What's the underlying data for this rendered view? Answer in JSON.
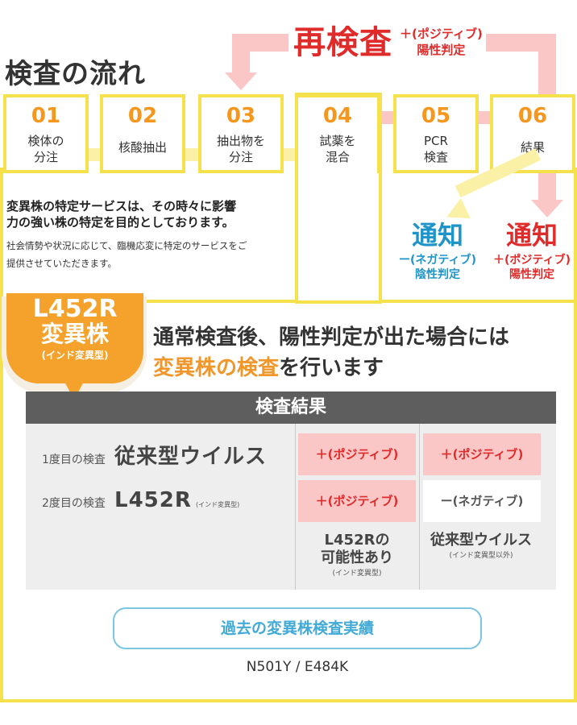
{
  "page_title": "検査の流れ",
  "retest": {
    "title": "再検査",
    "sub1": "＋(ポジティブ)",
    "sub2": "陽性判定"
  },
  "steps": [
    {
      "num": "01",
      "line1": "検体の",
      "line2": "分注"
    },
    {
      "num": "02",
      "line1": "核酸抽出",
      "line2": ""
    },
    {
      "num": "03",
      "line1": "抽出物を",
      "line2": "分注"
    },
    {
      "num": "04",
      "line1": "試薬を",
      "line2": "混合"
    },
    {
      "num": "05",
      "line1": "PCR",
      "line2": "検査"
    },
    {
      "num": "06",
      "line1": "結果",
      "line2": ""
    }
  ],
  "intro": {
    "bold_line1": "変異株の特定サービスは、その時々に影響",
    "bold_line2": "力の強い株の特定を目的としております。",
    "small_line1": "社会情勢や状況に応じて、臨機応変に特定のサービスをご",
    "small_line2": "提供させていただきます。"
  },
  "notices": {
    "negative": {
      "title": "通知",
      "line1": "ー(ネガティブ)",
      "line2": "陰性判定"
    },
    "positive": {
      "title": "通知",
      "line1": "＋(ポジティブ)",
      "line2": "陽性判定"
    }
  },
  "badge": {
    "line1": "L452R",
    "line2": "変異株",
    "line3": "(インド変異型)"
  },
  "headline": {
    "part1": "通常検査後、陽性判定が出た場合には",
    "highlight": "変異株の検査",
    "part2": "を行います"
  },
  "results": {
    "header": "検査結果",
    "row1": {
      "label": "1度目の検査",
      "main": "従来型ウイルス",
      "tiny": ""
    },
    "row2": {
      "label": "2度目の検査",
      "main": "L452R",
      "tiny": "(インド変異型)"
    },
    "col1": {
      "r1": "＋(ポジティブ)",
      "r2": "＋(ポジティブ)",
      "cap1": "L452Rの",
      "cap2": "可能性あり",
      "cap3": "(インド変異型)"
    },
    "col2": {
      "r1": "＋(ポジティブ)",
      "r2": "ー(ネガティブ)",
      "cap1": "従来型ウイルス",
      "cap2": "",
      "cap3": "(インド変異型以外)"
    }
  },
  "past": {
    "button": "過去の変異株検査実績",
    "value": "N501Y / E484K"
  },
  "colors": {
    "yellow": "#f4e14c",
    "orange": "#f5961e",
    "pink": "#fbc6c6",
    "red": "#e02b2b",
    "blue": "#1f94c8",
    "gray_header": "#5e5e5e"
  }
}
